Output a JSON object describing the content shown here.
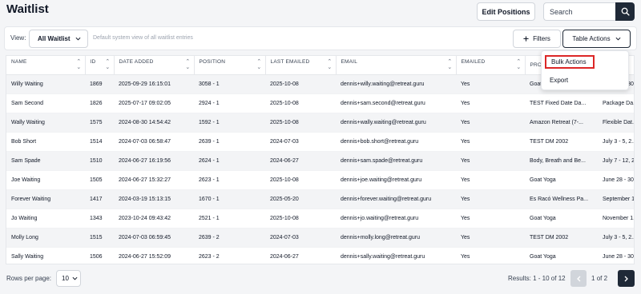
{
  "page": {
    "title": "Waitlist"
  },
  "header": {
    "edit_positions_label": "Edit Positions",
    "search_placeholder": "Search"
  },
  "toolbar": {
    "view_label": "View:",
    "view_value": "All Waitlist",
    "view_description": "Default system view of all waitlist entries",
    "filters_label": "Filters",
    "table_actions_label": "Table Actions"
  },
  "dropdown": {
    "items": [
      {
        "label": "Bulk Actions",
        "highlighted": true
      },
      {
        "label": "Export"
      }
    ]
  },
  "table": {
    "columns": [
      "NAME",
      "ID",
      "DATE ADDED",
      "POSITION",
      "LAST EMAILED",
      "EMAIL",
      "EMAILED",
      "PRO",
      ""
    ],
    "rows": [
      [
        "Willy Waiting",
        "1869",
        "2025-09-29 16:15:01",
        "3058 - 1",
        "2025-10-08",
        "dennis+willy.waiting@retreat.guru",
        "Yes",
        "Goat Yoga",
        "June 28 - 30"
      ],
      [
        "Sam Second",
        "1826",
        "2025-07-17 09:02:05",
        "2924 - 1",
        "2025-10-08",
        "dennis+sam.second@retreat.guru",
        "Yes",
        "TEST Fixed Date Da...",
        "Package Da..."
      ],
      [
        "Wally Waiting",
        "1575",
        "2024-08-30 14:54:42",
        "1592 - 1",
        "2025-10-08",
        "dennis+wally.waiting@retreat.guru",
        "Yes",
        "Amazon Retreat (7-...",
        "Flexible Dat..."
      ],
      [
        "Bob Short",
        "1514",
        "2024-07-03 06:58:47",
        "2639 - 1",
        "2024-07-03",
        "dennis+bob.short@retreat.guru",
        "Yes",
        "TEST DM 2002",
        "July 3 - 5, 2..."
      ],
      [
        "Sam Spade",
        "1510",
        "2024-06-27 16:19:56",
        "2624 - 1",
        "2024-06-27",
        "dennis+sam.spade@retreat.guru",
        "Yes",
        "Body, Breath and Be...",
        "July 7 - 12, 2..."
      ],
      [
        "Joe Waiting",
        "1505",
        "2024-06-27 15:32:27",
        "2623 - 1",
        "2025-10-08",
        "dennis+joe.waiting@retreat.guru",
        "Yes",
        "Goat Yoga",
        "June 28 - 30"
      ],
      [
        "Forever Waiting",
        "1417",
        "2024-03-19 15:13:15",
        "1670 - 1",
        "2025-05-20",
        "dennis+forever.waiting@retreat.guru",
        "Yes",
        "Es Racó Wellness Pa...",
        "September 1..."
      ],
      [
        "Jo Waiting",
        "1343",
        "2023-10-24 09:43:42",
        "2521 - 1",
        "2025-10-08",
        "dennis+jo.waiting@retreat.guru",
        "Yes",
        "Goat Yoga",
        "November 1..."
      ],
      [
        "Molly Long",
        "1515",
        "2024-07-03 06:59:45",
        "2639 - 2",
        "2024-07-03",
        "dennis+molly.long@retreat.guru",
        "Yes",
        "TEST DM 2002",
        "July 3 - 5, 2..."
      ],
      [
        "Sally Waiting",
        "1506",
        "2024-06-27 15:52:09",
        "2623 - 2",
        "2024-06-27",
        "dennis+sally.waiting@retreat.guru",
        "Yes",
        "Goat Yoga",
        "June 28 - 30"
      ]
    ]
  },
  "footer": {
    "rows_per_page_label": "Rows per page:",
    "rows_per_page_value": "10",
    "results_text": "Results: 1 - 10 of 12",
    "current_page": "1",
    "of_label": "of",
    "total_pages": "2"
  },
  "colors": {
    "accent_dark": "#1f2937",
    "highlight_border": "#dc2626"
  },
  "icons": [
    "search-icon",
    "chevron-down-icon",
    "plus-icon",
    "sort-icon",
    "chevron-left-icon",
    "chevron-right-icon"
  ]
}
